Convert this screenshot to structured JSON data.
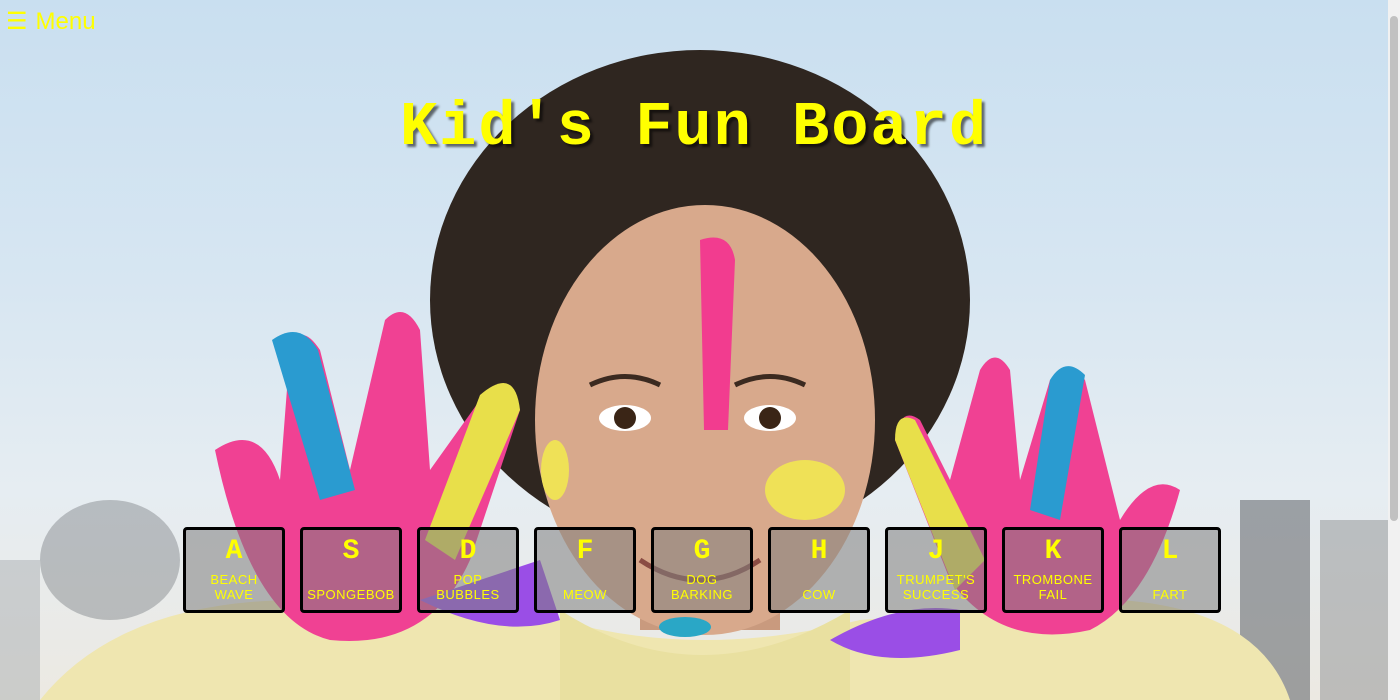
{
  "menu": {
    "icon": "hamburger-icon",
    "glyph": "☰",
    "label": "Menu"
  },
  "title": "Kid's Fun Board",
  "keys": [
    {
      "letter": "A",
      "sound": "BEACH\nWAVE"
    },
    {
      "letter": "S",
      "sound": "SPONGEBOB"
    },
    {
      "letter": "D",
      "sound": "POP\nBUBBLES"
    },
    {
      "letter": "F",
      "sound": "MEOW"
    },
    {
      "letter": "G",
      "sound": "DOG\nBARKING"
    },
    {
      "letter": "H",
      "sound": "COW"
    },
    {
      "letter": "J",
      "sound": "TRUMPET'S\nSUCCESS"
    },
    {
      "letter": "K",
      "sound": "TROMBONE\nFAIL"
    },
    {
      "letter": "L",
      "sound": "FART"
    }
  ],
  "colors": {
    "accent": "#ffff00",
    "key_border": "#000000"
  }
}
